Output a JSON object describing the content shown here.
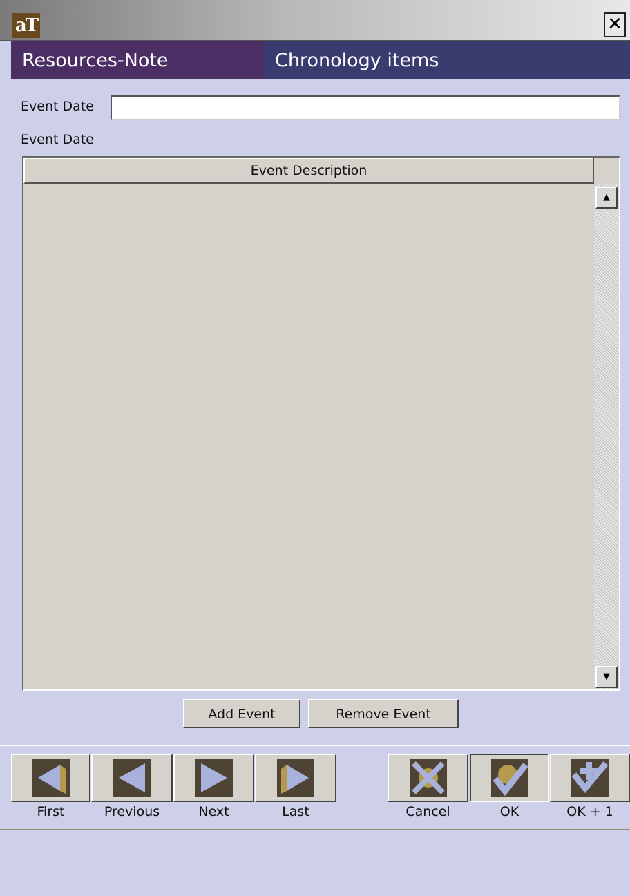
{
  "window": {
    "logo_text": "aT",
    "close_glyph": "✕"
  },
  "header": {
    "left_title": "Resources-Note",
    "right_title": "Chronology items"
  },
  "form": {
    "event_date_label": "Event Date",
    "event_date_value": "",
    "event_date_list_label": "Event Date"
  },
  "table": {
    "columns": [
      "Event Description"
    ],
    "rows": []
  },
  "buttons": {
    "add_event": "Add Event",
    "remove_event": "Remove Event"
  },
  "nav": {
    "first": "First",
    "previous": "Previous",
    "next": "Next",
    "last": "Last",
    "cancel": "Cancel",
    "ok": "OK",
    "ok_plus_one": "OK + 1"
  },
  "icons": {
    "app_logo": "at-logo-icon",
    "close": "close-icon",
    "scroll_up": "scroll-up-icon",
    "scroll_down": "scroll-down-icon",
    "first": "first-arrow-icon",
    "previous": "previous-arrow-icon",
    "next": "next-arrow-icon",
    "last": "last-arrow-icon",
    "cancel": "cancel-x-icon",
    "ok": "ok-check-icon",
    "ok_plus_one": "ok-plus-icon"
  },
  "colors": {
    "background": "#cdd0e8",
    "header_left": "#4a2e64",
    "header_right": "#3a3c70",
    "table_bg": "#d5d1cb",
    "icon_dark": "#4e4435",
    "icon_light": "#a8b0dc"
  }
}
